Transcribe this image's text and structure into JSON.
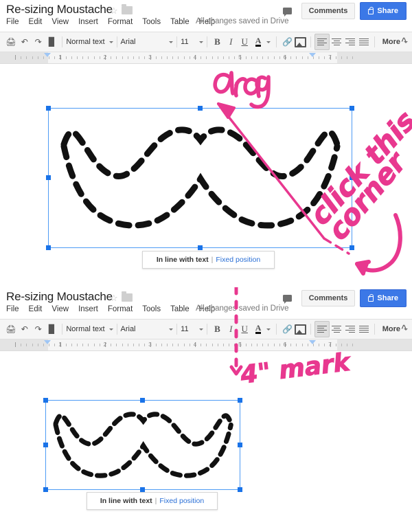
{
  "panels": [
    {
      "id": "panel-1",
      "header": {
        "doc_title": "Re-sizing Moustache",
        "star_icon": "star-icon",
        "folder_icon": "folder-icon",
        "menu": [
          "File",
          "Edit",
          "View",
          "Insert",
          "Format",
          "Tools",
          "Table",
          "Help"
        ],
        "save_status": "All changes saved in Drive",
        "comment_icon": "comment-bubble-icon",
        "comments_label": "Comments",
        "share_label": "Share",
        "share_lock_icon": "lock-icon",
        "share_color": "#3b78e7"
      },
      "toolbar": {
        "print_icon": "print-icon",
        "undo_icon": "undo-icon",
        "redo_icon": "redo-icon",
        "paint_format_icon": "paint-format-icon",
        "style": "Normal text",
        "font": "Arial",
        "size": "11",
        "bold": "B",
        "italic": "I",
        "underline": "U",
        "text_color": "A",
        "link_icon": "link-icon",
        "image_icon": "insert-image-icon",
        "align_left_icon": "align-left-icon",
        "align_center_icon": "align-center-icon",
        "align_right_icon": "align-right-icon",
        "align_justify_icon": "align-justify-icon",
        "more_label": "More",
        "collapse_icon": "collapse-toolbar-icon"
      },
      "ruler": {
        "numbers": [
          "1",
          "2",
          "3",
          "4",
          "5",
          "6",
          "7"
        ]
      },
      "image": {
        "name": "moustache-image",
        "position_bar": {
          "inline_label": "In line with text",
          "separator": "|",
          "fixed_label": "Fixed position"
        }
      },
      "annotations": [
        {
          "name": "drag-annotation",
          "text": "drag",
          "color": "#e8388f"
        },
        {
          "name": "click-this-annotation",
          "text": "click this",
          "color": "#e8388f"
        },
        {
          "name": "corner-annotation",
          "text": "corner",
          "color": "#e8388f"
        }
      ]
    },
    {
      "id": "panel-2",
      "header": {
        "doc_title": "Re-sizing Moustache",
        "star_icon": "star-icon",
        "folder_icon": "folder-icon",
        "menu": [
          "File",
          "Edit",
          "View",
          "Insert",
          "Format",
          "Tools",
          "Table",
          "Help"
        ],
        "save_status": "All changes saved in Drive",
        "comment_icon": "comment-bubble-icon",
        "comments_label": "Comments",
        "share_label": "Share",
        "share_lock_icon": "lock-icon",
        "share_color": "#3b78e7"
      },
      "toolbar": {
        "print_icon": "print-icon",
        "undo_icon": "undo-icon",
        "redo_icon": "redo-icon",
        "paint_format_icon": "paint-format-icon",
        "style": "Normal text",
        "font": "Arial",
        "size": "11",
        "bold": "B",
        "italic": "I",
        "underline": "U",
        "text_color": "A",
        "link_icon": "link-icon",
        "image_icon": "insert-image-icon",
        "align_left_icon": "align-left-icon",
        "align_center_icon": "align-center-icon",
        "align_right_icon": "align-right-icon",
        "align_justify_icon": "align-justify-icon",
        "more_label": "More",
        "collapse_icon": "collapse-toolbar-icon"
      },
      "ruler": {
        "numbers": [
          "1",
          "2",
          "3",
          "4",
          "5",
          "6",
          "7"
        ]
      },
      "image": {
        "name": "moustache-image",
        "position_bar": {
          "inline_label": "In line with text",
          "separator": "|",
          "fixed_label": "Fixed position"
        }
      },
      "annotations": [
        {
          "name": "four-inch-mark-annotation",
          "text": "4\" mark",
          "color": "#e8388f"
        }
      ]
    }
  ],
  "ink_color": "#e8388f",
  "selection_color": "#4d9bf5"
}
